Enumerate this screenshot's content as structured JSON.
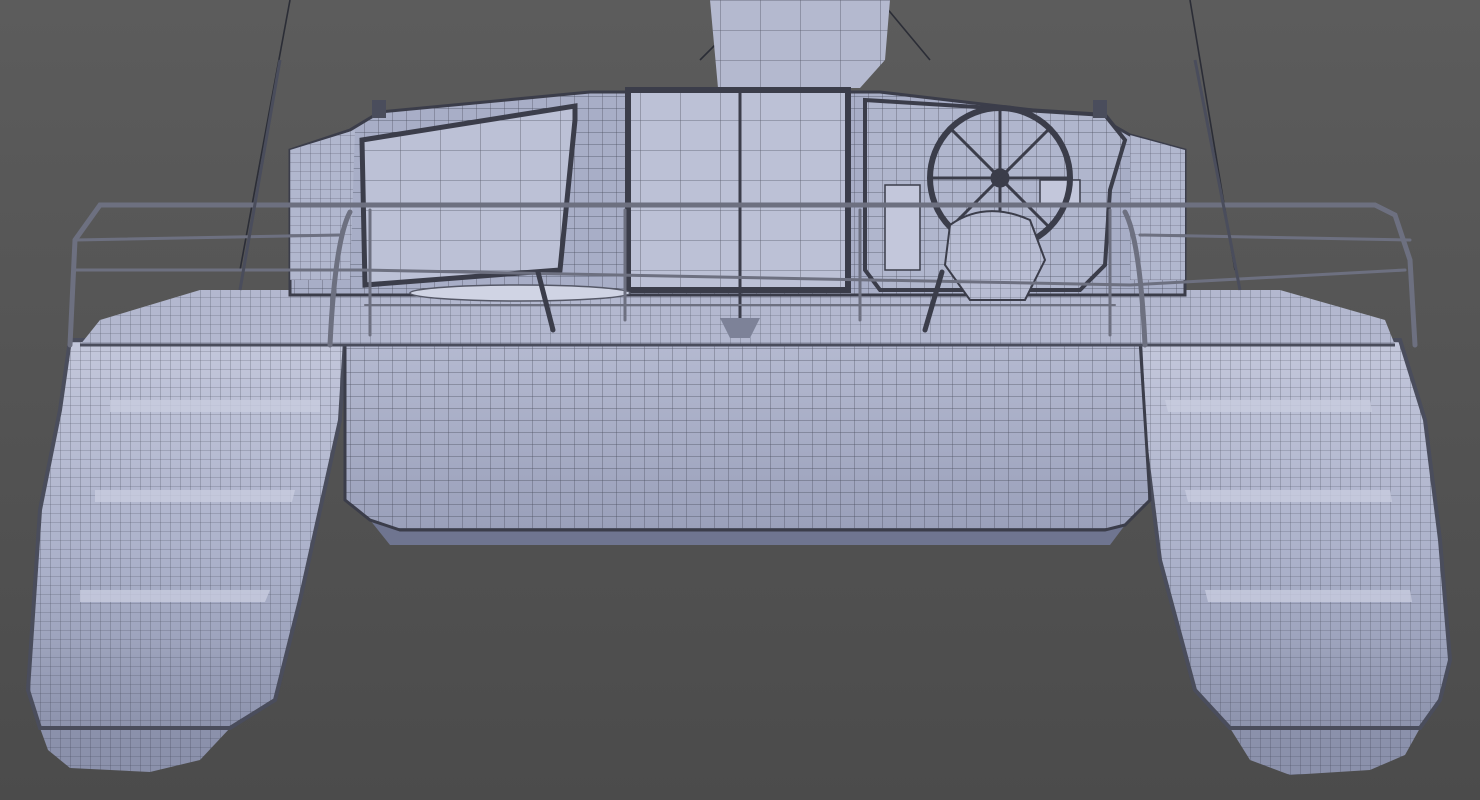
{
  "scene": {
    "subject": "catamaran-stern-wireframe-render",
    "colors": {
      "background_top": "#5c5c5c",
      "background_bottom": "#4b4b4b",
      "hull_fill": "#a9afc8",
      "hull_light": "#c9cde0",
      "hull_shadow": "#7d839c",
      "wire": "#2a2d3a",
      "panel": "#b7bcd3",
      "rail": "#6d7080",
      "frame": "#3b3d4a"
    }
  }
}
